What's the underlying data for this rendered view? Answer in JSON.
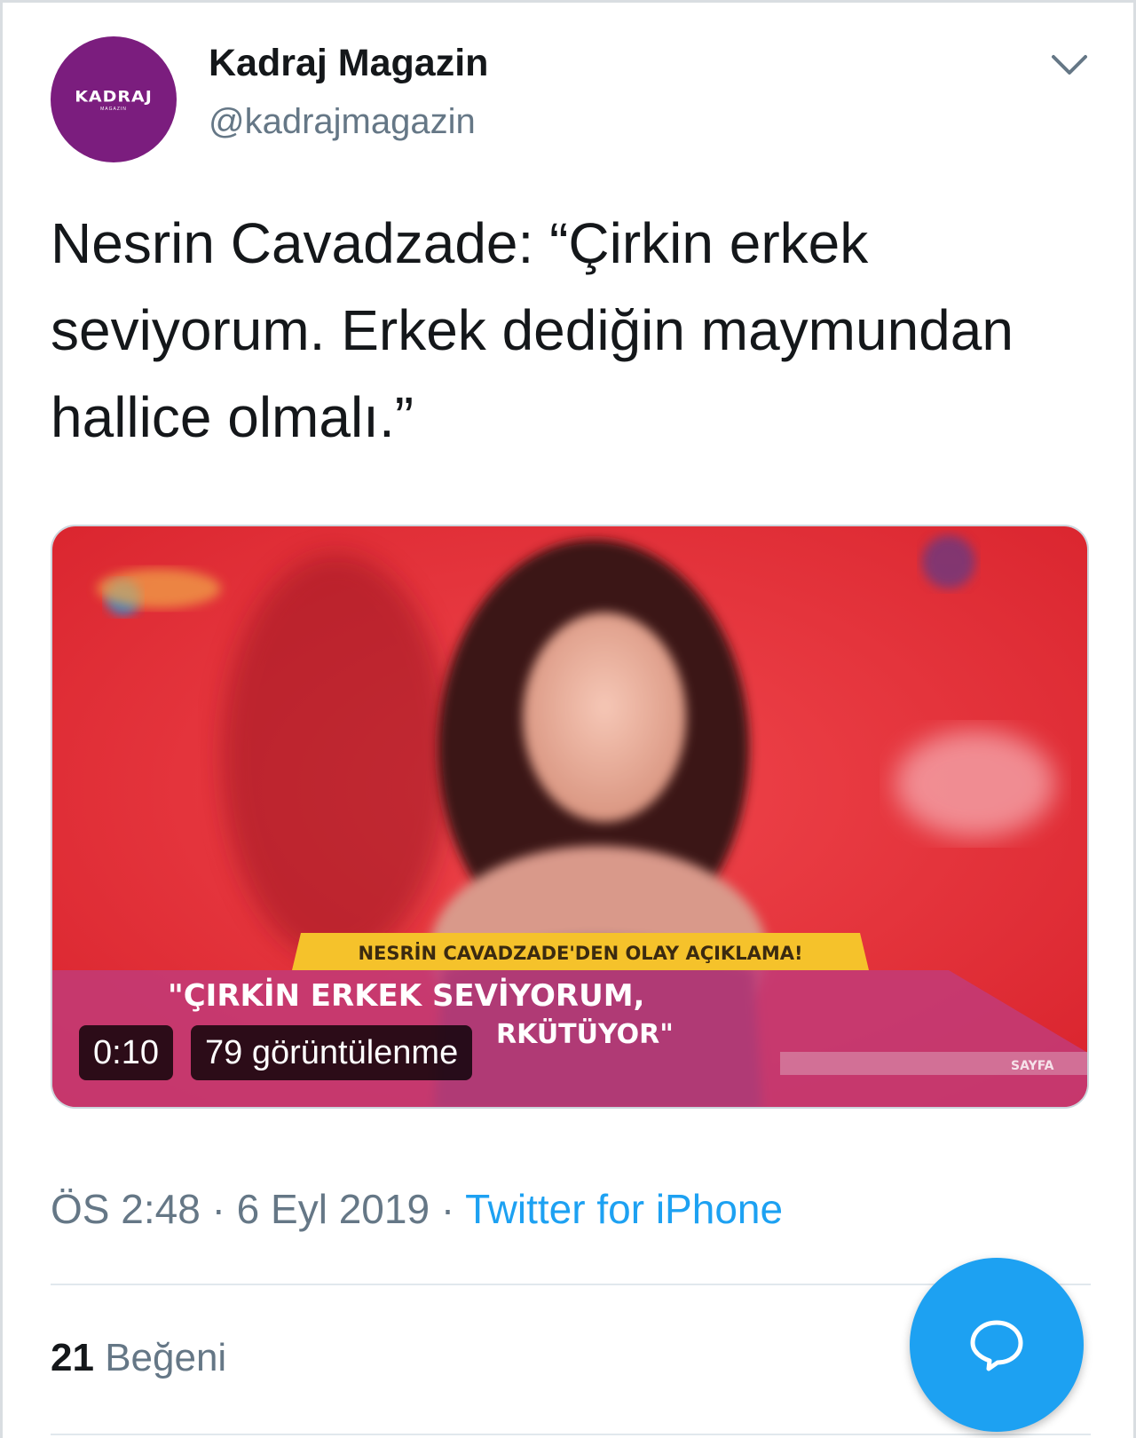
{
  "account": {
    "display_name": "Kadraj Magazin",
    "handle": "@kadrajmagazin",
    "avatar_brand": "KADRAJ",
    "avatar_sub": "MAGAZIN"
  },
  "tweet": {
    "text": "Nesrin Cavadzade: “Çirkin erkek seviyorum. Erkek dediğin maymundan hallice olmalı.”",
    "time": "ÖS 2:48",
    "date": "6 Eyl 2019",
    "separator": "·",
    "source": "Twitter for iPhone"
  },
  "video": {
    "duration": "0:10",
    "views": "79 görüntülenme",
    "banner_title": "NESRİN CAVADZADE'DEN OLAY AÇIKLAMA!",
    "caption_line1": "\"ÇIRKİN ERKEK SEVİYORUM,",
    "caption_line2": "RKÜTÜYOR\"",
    "ticker": "SAYFA"
  },
  "engagement": {
    "likes_count": "21",
    "likes_label": "Beğeni"
  },
  "icons": {
    "menu": "chevron-down-icon",
    "compose": "reply-bubble-icon"
  },
  "colors": {
    "accent": "#1da1f2",
    "avatar_bg": "#7b1d7e",
    "text": "#14171a",
    "muted": "#657786"
  }
}
